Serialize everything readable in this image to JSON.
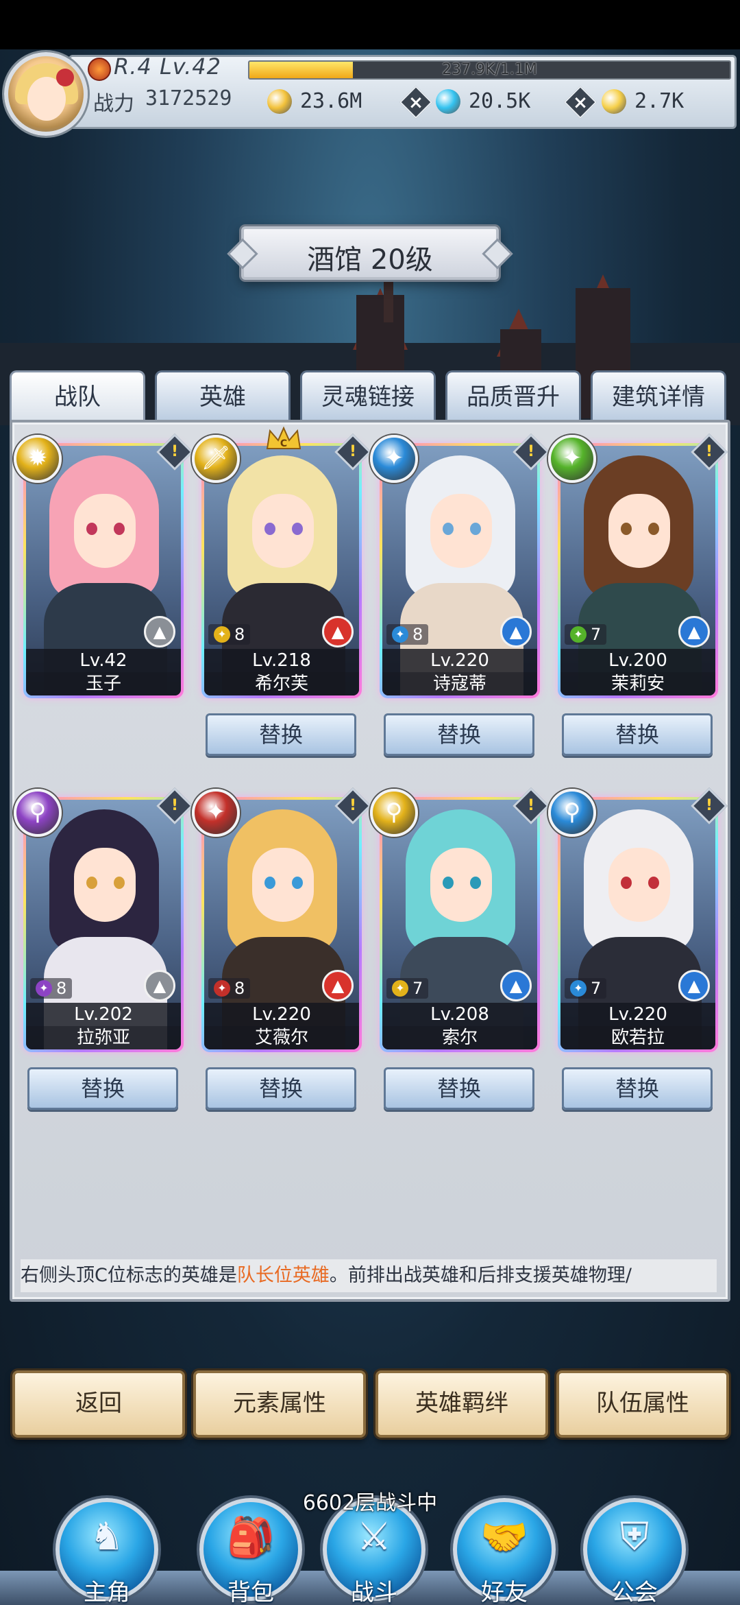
{
  "player": {
    "rank": "R.4 Lv.42",
    "exp_text": "237.9K/1.1M",
    "exp_fraction": 0.216,
    "power_label": "战力",
    "power_value": "3172529"
  },
  "currencies": [
    {
      "value": "23.6M",
      "icon": "gold-coin-icon",
      "color": "#f3c23b"
    },
    {
      "value": "20.5K",
      "icon": "blue-gem-icon",
      "color": "#34c3f0"
    },
    {
      "value": "2.7K",
      "icon": "gold-gem-icon",
      "color": "#f6d04a"
    }
  ],
  "title": "酒馆 20级",
  "tabs": [
    "战队",
    "英雄",
    "灵魂链接",
    "品质晋升",
    "建筑详情"
  ],
  "active_tab": "战队",
  "heroes": [
    {
      "name": "玉子",
      "level": "Lv.42",
      "stars": "",
      "element_color": "#e3b21a",
      "element_glyph": "✹",
      "class_color": "#8a8f96",
      "class_icon": "mage-hat-icon",
      "hair": "#f7a3b5",
      "body": "#2d3a4a",
      "eye": "#c2375a",
      "leader": false,
      "replace_label": ""
    },
    {
      "name": "希尔芙",
      "level": "Lv.218",
      "stars": "8",
      "element_color": "#e3b21a",
      "element_glyph": "🗡",
      "class_color": "#d8332c",
      "class_icon": "warrior-helm-icon",
      "hair": "#f2e2a6",
      "body": "#2b2a33",
      "eye": "#8a6ad0",
      "leader": true,
      "replace_label": "替换"
    },
    {
      "name": "诗寇蒂",
      "level": "Lv.220",
      "stars": "8",
      "element_color": "#2a8ad8",
      "element_glyph": "✦",
      "class_color": "#2a78d6",
      "class_icon": "mage-hat-icon",
      "hair": "#eceff4",
      "body": "#e8d8c8",
      "eye": "#6aa7d8",
      "leader": false,
      "replace_label": "替换"
    },
    {
      "name": "茉莉安",
      "level": "Lv.200",
      "stars": "7",
      "element_color": "#55b32a",
      "element_glyph": "✦",
      "class_color": "#2a78d6",
      "class_icon": "mage-hat-icon",
      "hair": "#6b3e24",
      "body": "#2f4a4c",
      "eye": "#8b5a2a",
      "leader": false,
      "replace_label": "替换"
    },
    {
      "name": "拉弥亚",
      "level": "Lv.202",
      "stars": "8",
      "element_color": "#8d43c4",
      "element_glyph": "⚲",
      "class_color": "#8a8f96",
      "class_icon": "warrior-helm-icon",
      "hair": "#2c2540",
      "body": "#e8e6ee",
      "eye": "#d8a03a",
      "leader": false,
      "replace_label": "替换"
    },
    {
      "name": "艾薇尔",
      "level": "Lv.220",
      "stars": "8",
      "element_color": "#c3302a",
      "element_glyph": "✦",
      "class_color": "#d8332c",
      "class_icon": "warrior-helm-icon",
      "hair": "#f0c063",
      "body": "#3a2f2a",
      "eye": "#3a9ad8",
      "leader": false,
      "replace_label": "替换"
    },
    {
      "name": "索尔",
      "level": "Lv.208",
      "stars": "7",
      "element_color": "#e3b21a",
      "element_glyph": "⚲",
      "class_color": "#2a78d6",
      "class_icon": "mage-hat-icon",
      "hair": "#6fd3d6",
      "body": "#3d4a5a",
      "eye": "#2a9ab8",
      "leader": false,
      "replace_label": "替换"
    },
    {
      "name": "欧若拉",
      "level": "Lv.220",
      "stars": "7",
      "element_color": "#2a8ad8",
      "element_glyph": "⚲",
      "class_color": "#2a78d6",
      "class_icon": "mage-hat-icon",
      "hair": "#eeeef2",
      "body": "#2b2d38",
      "eye": "#c2303a",
      "leader": false,
      "replace_label": "替换"
    }
  ],
  "hint": {
    "prefix": "右侧头顶C位标志的英雄是",
    "highlight": "队长位英雄",
    "suffix": "。前排出战英雄和后排支援英雄物理/"
  },
  "actions": [
    "返回",
    "元素属性",
    "英雄羁绊",
    "队伍属性"
  ],
  "battle_status": "6602层战斗中",
  "nav": [
    {
      "label": "主角",
      "icon": "hero-helmet-icon",
      "glyph": "♞"
    },
    {
      "label": "背包",
      "icon": "backpack-icon",
      "glyph": "🎒"
    },
    {
      "label": "战斗",
      "icon": "crossed-swords-icon",
      "glyph": "⚔"
    },
    {
      "label": "好友",
      "icon": "handshake-icon",
      "glyph": "🤝"
    },
    {
      "label": "公会",
      "icon": "guild-crest-icon",
      "glyph": "⛨"
    }
  ]
}
